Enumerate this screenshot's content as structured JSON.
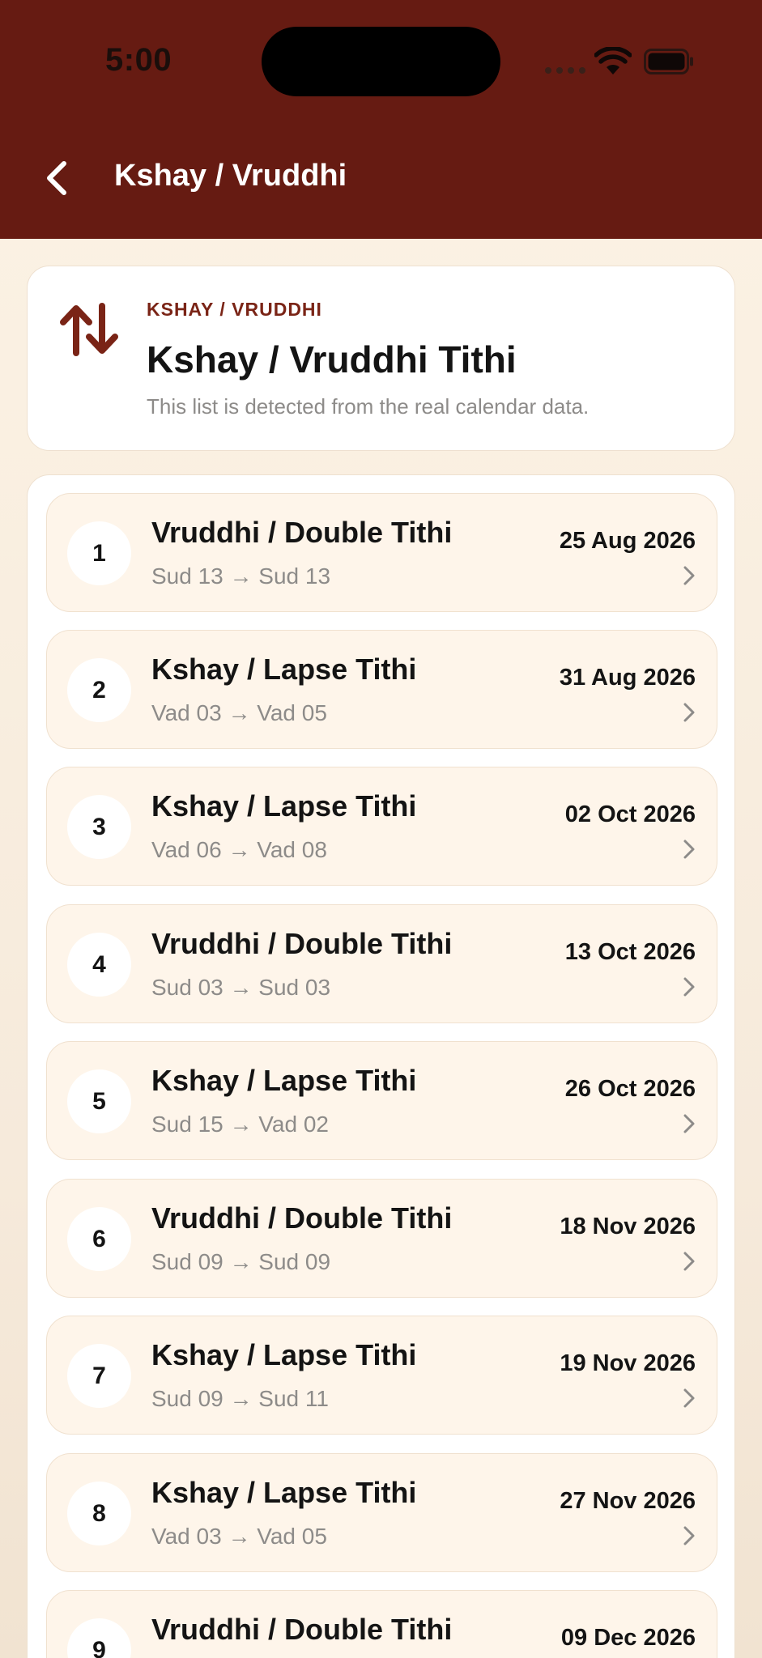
{
  "status_bar": {
    "time": "5:00"
  },
  "nav": {
    "title": "Kshay / Vruddhi",
    "back_icon": "chevron-left-icon"
  },
  "summary": {
    "icon": "arrows-up-down-icon",
    "eyebrow": "KSHAY / VRUDDHI",
    "title": "Kshay / Vruddhi Tithi",
    "subtitle": "This list is detected from the real calendar data."
  },
  "items": [
    {
      "index": "1",
      "title": "Vruddhi / Double Tithi",
      "subtitle": "Sud 13 → Sud 13",
      "date": "25 Aug 2026"
    },
    {
      "index": "2",
      "title": "Kshay / Lapse Tithi",
      "subtitle": "Vad 03 → Vad 05",
      "date": "31 Aug 2026"
    },
    {
      "index": "3",
      "title": "Kshay / Lapse Tithi",
      "subtitle": "Vad 06 → Vad 08",
      "date": "02 Oct 2026"
    },
    {
      "index": "4",
      "title": "Vruddhi / Double Tithi",
      "subtitle": "Sud 03 → Sud 03",
      "date": "13 Oct 2026"
    },
    {
      "index": "5",
      "title": "Kshay / Lapse Tithi",
      "subtitle": "Sud 15 → Vad 02",
      "date": "26 Oct 2026"
    },
    {
      "index": "6",
      "title": "Vruddhi / Double Tithi",
      "subtitle": "Sud 09 → Sud 09",
      "date": "18 Nov 2026"
    },
    {
      "index": "7",
      "title": "Kshay / Lapse Tithi",
      "subtitle": "Sud 09 → Sud 11",
      "date": "19 Nov 2026"
    },
    {
      "index": "8",
      "title": "Kshay / Lapse Tithi",
      "subtitle": "Vad 03 → Vad 05",
      "date": "27 Nov 2026"
    },
    {
      "index": "9",
      "title": "Vruddhi / Double Tithi",
      "subtitle": "",
      "date": "09 Dec 2026"
    }
  ],
  "colors": {
    "header_bg": "#661B12",
    "accent": "#7A2416",
    "item_bg": "#FEF5EA",
    "page_bg": "#F6EADB"
  }
}
